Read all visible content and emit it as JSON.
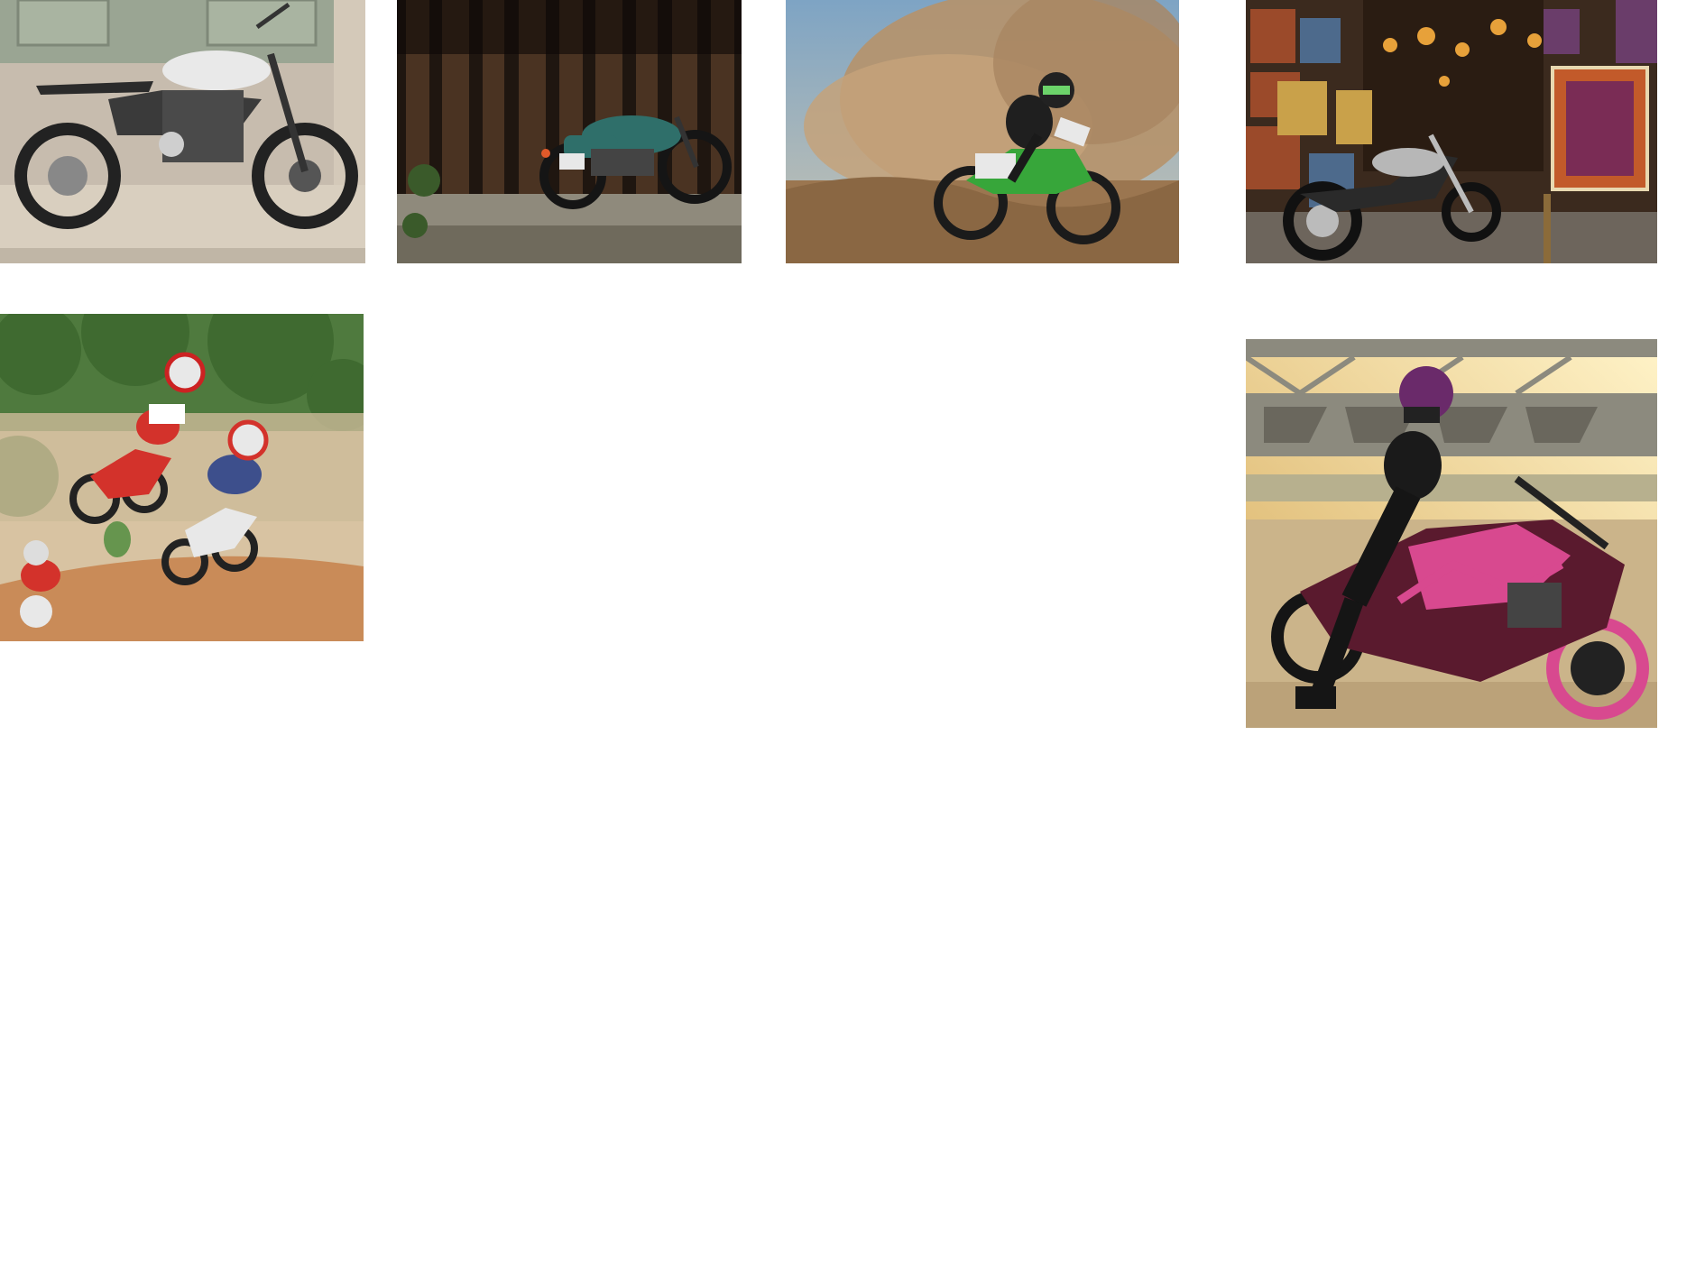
{
  "gallery": {
    "photos": [
      {
        "id": "cafe-racer-motorcycle",
        "palette": {
          "bg": "#b8ad9f",
          "wall": "#9aa593",
          "ground": "#cfc4b4",
          "body": "#e9e9e9",
          "dark": "#222222"
        }
      },
      {
        "id": "green-classic-motorcycle",
        "palette": {
          "bg": "#2a1d14",
          "wall": "#4a3322",
          "ground": "#8f8a7c",
          "body": "#2f6f6a",
          "dark": "#151515"
        }
      },
      {
        "id": "motocross-rider-dust",
        "palette": {
          "sky": "#8fb2cf",
          "dust": "#b6926a",
          "ground": "#9b7650",
          "body": "#37a63a",
          "dark": "#1b1b1b"
        }
      },
      {
        "id": "chopper-art-shop",
        "palette": {
          "bg": "#3b2a1e",
          "art": "#9b4a2a",
          "lamp": "#e7a13a",
          "body": "#b7b7b7",
          "dark": "#111111"
        }
      },
      {
        "id": "motocross-jump-race",
        "palette": {
          "trees": "#4f7a3e",
          "haze": "#d8c3a2",
          "ground": "#c98b58",
          "red": "#d3322b",
          "blue": "#3d4f8c"
        }
      },
      {
        "id": "pink-stunt-bike-rider",
        "palette": {
          "sky": "#f2d188",
          "bridge": "#8c8a7e",
          "ground": "#cbb48a",
          "pink": "#d8498f",
          "dark": "#151515"
        }
      }
    ]
  }
}
